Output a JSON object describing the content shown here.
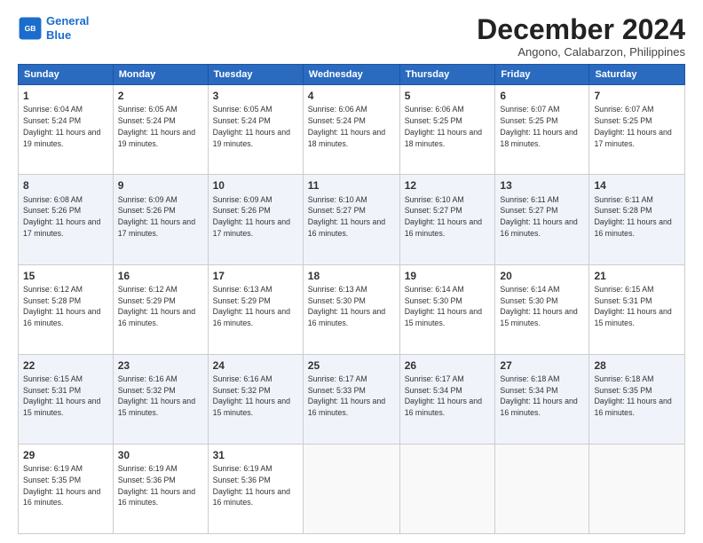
{
  "logo": {
    "line1": "General",
    "line2": "Blue"
  },
  "title": "December 2024",
  "location": "Angono, Calabarzon, Philippines",
  "days_of_week": [
    "Sunday",
    "Monday",
    "Tuesday",
    "Wednesday",
    "Thursday",
    "Friday",
    "Saturday"
  ],
  "weeks": [
    [
      {
        "day": "1",
        "sunrise": "6:04 AM",
        "sunset": "5:24 PM",
        "daylight": "11 hours and 19 minutes."
      },
      {
        "day": "2",
        "sunrise": "6:05 AM",
        "sunset": "5:24 PM",
        "daylight": "11 hours and 19 minutes."
      },
      {
        "day": "3",
        "sunrise": "6:05 AM",
        "sunset": "5:24 PM",
        "daylight": "11 hours and 19 minutes."
      },
      {
        "day": "4",
        "sunrise": "6:06 AM",
        "sunset": "5:24 PM",
        "daylight": "11 hours and 18 minutes."
      },
      {
        "day": "5",
        "sunrise": "6:06 AM",
        "sunset": "5:25 PM",
        "daylight": "11 hours and 18 minutes."
      },
      {
        "day": "6",
        "sunrise": "6:07 AM",
        "sunset": "5:25 PM",
        "daylight": "11 hours and 18 minutes."
      },
      {
        "day": "7",
        "sunrise": "6:07 AM",
        "sunset": "5:25 PM",
        "daylight": "11 hours and 17 minutes."
      }
    ],
    [
      {
        "day": "8",
        "sunrise": "6:08 AM",
        "sunset": "5:26 PM",
        "daylight": "11 hours and 17 minutes."
      },
      {
        "day": "9",
        "sunrise": "6:09 AM",
        "sunset": "5:26 PM",
        "daylight": "11 hours and 17 minutes."
      },
      {
        "day": "10",
        "sunrise": "6:09 AM",
        "sunset": "5:26 PM",
        "daylight": "11 hours and 17 minutes."
      },
      {
        "day": "11",
        "sunrise": "6:10 AM",
        "sunset": "5:27 PM",
        "daylight": "11 hours and 16 minutes."
      },
      {
        "day": "12",
        "sunrise": "6:10 AM",
        "sunset": "5:27 PM",
        "daylight": "11 hours and 16 minutes."
      },
      {
        "day": "13",
        "sunrise": "6:11 AM",
        "sunset": "5:27 PM",
        "daylight": "11 hours and 16 minutes."
      },
      {
        "day": "14",
        "sunrise": "6:11 AM",
        "sunset": "5:28 PM",
        "daylight": "11 hours and 16 minutes."
      }
    ],
    [
      {
        "day": "15",
        "sunrise": "6:12 AM",
        "sunset": "5:28 PM",
        "daylight": "11 hours and 16 minutes."
      },
      {
        "day": "16",
        "sunrise": "6:12 AM",
        "sunset": "5:29 PM",
        "daylight": "11 hours and 16 minutes."
      },
      {
        "day": "17",
        "sunrise": "6:13 AM",
        "sunset": "5:29 PM",
        "daylight": "11 hours and 16 minutes."
      },
      {
        "day": "18",
        "sunrise": "6:13 AM",
        "sunset": "5:30 PM",
        "daylight": "11 hours and 16 minutes."
      },
      {
        "day": "19",
        "sunrise": "6:14 AM",
        "sunset": "5:30 PM",
        "daylight": "11 hours and 15 minutes."
      },
      {
        "day": "20",
        "sunrise": "6:14 AM",
        "sunset": "5:30 PM",
        "daylight": "11 hours and 15 minutes."
      },
      {
        "day": "21",
        "sunrise": "6:15 AM",
        "sunset": "5:31 PM",
        "daylight": "11 hours and 15 minutes."
      }
    ],
    [
      {
        "day": "22",
        "sunrise": "6:15 AM",
        "sunset": "5:31 PM",
        "daylight": "11 hours and 15 minutes."
      },
      {
        "day": "23",
        "sunrise": "6:16 AM",
        "sunset": "5:32 PM",
        "daylight": "11 hours and 15 minutes."
      },
      {
        "day": "24",
        "sunrise": "6:16 AM",
        "sunset": "5:32 PM",
        "daylight": "11 hours and 15 minutes."
      },
      {
        "day": "25",
        "sunrise": "6:17 AM",
        "sunset": "5:33 PM",
        "daylight": "11 hours and 16 minutes."
      },
      {
        "day": "26",
        "sunrise": "6:17 AM",
        "sunset": "5:34 PM",
        "daylight": "11 hours and 16 minutes."
      },
      {
        "day": "27",
        "sunrise": "6:18 AM",
        "sunset": "5:34 PM",
        "daylight": "11 hours and 16 minutes."
      },
      {
        "day": "28",
        "sunrise": "6:18 AM",
        "sunset": "5:35 PM",
        "daylight": "11 hours and 16 minutes."
      }
    ],
    [
      {
        "day": "29",
        "sunrise": "6:19 AM",
        "sunset": "5:35 PM",
        "daylight": "11 hours and 16 minutes."
      },
      {
        "day": "30",
        "sunrise": "6:19 AM",
        "sunset": "5:36 PM",
        "daylight": "11 hours and 16 minutes."
      },
      {
        "day": "31",
        "sunrise": "6:19 AM",
        "sunset": "5:36 PM",
        "daylight": "11 hours and 16 minutes."
      },
      null,
      null,
      null,
      null
    ]
  ]
}
